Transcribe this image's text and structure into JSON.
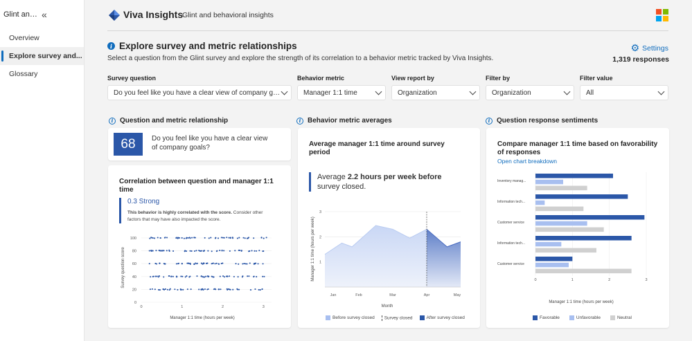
{
  "sidebar": {
    "title": "Glint and behavioral...",
    "items": [
      {
        "label": "Overview"
      },
      {
        "label": "Explore survey and..."
      },
      {
        "label": "Glossary"
      }
    ]
  },
  "header": {
    "brand": "Viva Insights",
    "subtitle": "Glint and behavioral insights"
  },
  "page": {
    "title": "Explore survey and metric relationships",
    "description": "Select a question from the Glint survey and explore the strength of its correlation to a behavior metric tracked by Viva Insights.",
    "settings_label": "Settings",
    "responses": "1,319 responses"
  },
  "filters": [
    {
      "label": "Survey question",
      "value": "Do you feel like you have a clear view of company goals?"
    },
    {
      "label": "Behavior metric",
      "value": "Manager 1:1 time"
    },
    {
      "label": "View report by",
      "value": "Organization"
    },
    {
      "label": "Filter by",
      "value": "Organization"
    },
    {
      "label": "Filter value",
      "value": "All"
    }
  ],
  "sections": {
    "relationship": "Question and metric relationship",
    "averages": "Behavior metric averages",
    "sentiments": "Question response sentiments"
  },
  "question_card": {
    "score": "68",
    "text": "Do you feel like you have a clear view of company goals?"
  },
  "correlation": {
    "title": "Correlation between question and manager 1:1 time",
    "strength": "0.3 Strong",
    "note_bold": "This behavior is highly correlated with the score.",
    "note": " Consider other factors that may have also impacted the score."
  },
  "averages": {
    "title": "Average manager 1:1 time around survey period",
    "text_pre": "Average ",
    "text_bold": "2.2 hours per week before",
    "text_post": " survey closed."
  },
  "sentiments": {
    "title": "Compare manager 1:1 time based on favorability of responses",
    "link": "Open chart breakdown"
  },
  "colors": {
    "accent": "#2b57a8",
    "light": "#a8bff0",
    "neutral": "#d0d0d0",
    "link": "#0f6cbd"
  },
  "chart_data": [
    {
      "type": "scatter",
      "xlabel": "Manager 1:1 time (hours per week)",
      "ylabel": "Survey question score",
      "xlim": [
        0,
        3.2
      ],
      "ylim": [
        0,
        100
      ],
      "xticks": [
        0,
        1,
        2,
        3
      ],
      "yticks": [
        0,
        20,
        40,
        60,
        80,
        100
      ],
      "score_levels": [
        20,
        40,
        60,
        80,
        100
      ],
      "x_range": [
        0.2,
        3.1
      ]
    },
    {
      "type": "area",
      "xlabel": "Month",
      "ylabel": "Manager 1:1 time (hours per week)",
      "categories": [
        "Jan",
        "Feb",
        "Mar",
        "Apr",
        "May"
      ],
      "ylim": [
        0,
        3
      ],
      "yticks": [
        1,
        2,
        3
      ],
      "survey_closed": 3,
      "x": [
        0,
        0.5,
        0.8,
        1.5,
        2.0,
        2.5,
        3.0,
        3.6,
        4.0
      ],
      "values": [
        1.3,
        1.75,
        1.6,
        2.45,
        2.3,
        1.95,
        2.3,
        1.6,
        1.8
      ],
      "legend": [
        "Before survey closed",
        "Survey closed",
        "After survey closed"
      ]
    },
    {
      "type": "bar",
      "orientation": "horizontal",
      "xlabel": "Manager 1:1 time (hours per week)",
      "xlim": [
        0,
        3
      ],
      "xticks": [
        0,
        1,
        2,
        3
      ],
      "categories": [
        "Inventory manag...",
        "Information tech...",
        "Customer service",
        "Information tech...",
        "Customer service"
      ],
      "series": [
        {
          "name": "Favorable",
          "values": [
            2.1,
            2.5,
            2.95,
            2.6,
            1.0
          ]
        },
        {
          "name": "Unfavorable",
          "values": [
            0.75,
            0.25,
            1.4,
            0.7,
            0.9
          ]
        },
        {
          "name": "Neutral",
          "values": [
            1.4,
            1.3,
            1.85,
            1.65,
            2.6
          ]
        }
      ]
    }
  ]
}
